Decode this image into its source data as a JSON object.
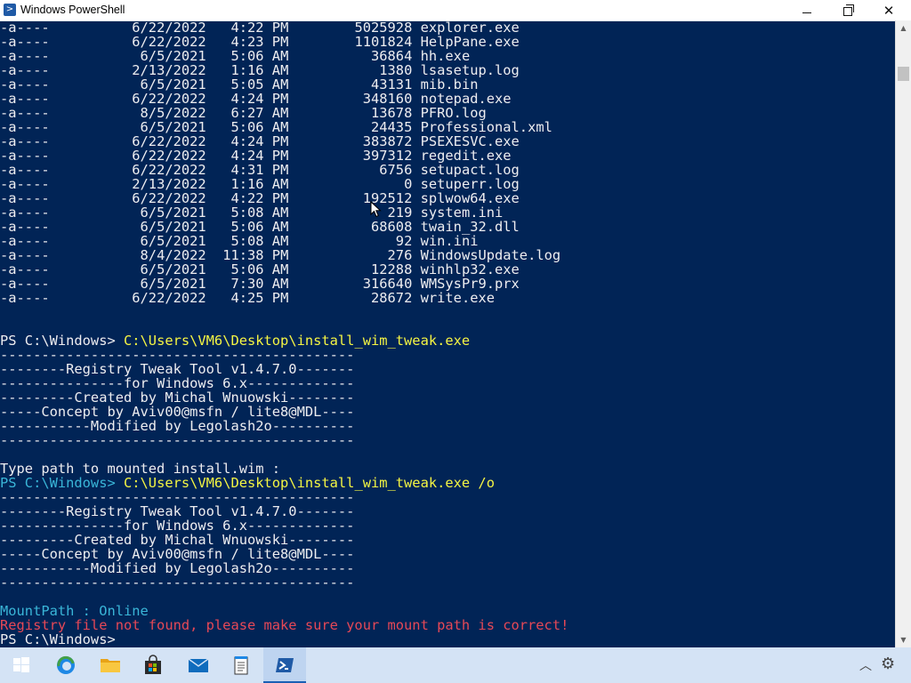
{
  "window": {
    "title": "Windows PowerShell"
  },
  "listing": [
    {
      "mode": "-a----",
      "date": "6/22/2022",
      "time": "4:22 PM",
      "length": "5025928",
      "name": "explorer.exe"
    },
    {
      "mode": "-a----",
      "date": "6/22/2022",
      "time": "4:23 PM",
      "length": "1101824",
      "name": "HelpPane.exe"
    },
    {
      "mode": "-a----",
      "date": "6/5/2021",
      "time": "5:06 AM",
      "length": "36864",
      "name": "hh.exe"
    },
    {
      "mode": "-a----",
      "date": "2/13/2022",
      "time": "1:16 AM",
      "length": "1380",
      "name": "lsasetup.log"
    },
    {
      "mode": "-a----",
      "date": "6/5/2021",
      "time": "5:05 AM",
      "length": "43131",
      "name": "mib.bin"
    },
    {
      "mode": "-a----",
      "date": "6/22/2022",
      "time": "4:24 PM",
      "length": "348160",
      "name": "notepad.exe"
    },
    {
      "mode": "-a----",
      "date": "8/5/2022",
      "time": "6:27 AM",
      "length": "13678",
      "name": "PFRO.log"
    },
    {
      "mode": "-a----",
      "date": "6/5/2021",
      "time": "5:06 AM",
      "length": "24435",
      "name": "Professional.xml"
    },
    {
      "mode": "-a----",
      "date": "6/22/2022",
      "time": "4:24 PM",
      "length": "383872",
      "name": "PSEXESVC.exe"
    },
    {
      "mode": "-a----",
      "date": "6/22/2022",
      "time": "4:24 PM",
      "length": "397312",
      "name": "regedit.exe"
    },
    {
      "mode": "-a----",
      "date": "6/22/2022",
      "time": "4:31 PM",
      "length": "6756",
      "name": "setupact.log"
    },
    {
      "mode": "-a----",
      "date": "2/13/2022",
      "time": "1:16 AM",
      "length": "0",
      "name": "setuperr.log"
    },
    {
      "mode": "-a----",
      "date": "6/22/2022",
      "time": "4:22 PM",
      "length": "192512",
      "name": "splwow64.exe"
    },
    {
      "mode": "-a----",
      "date": "6/5/2021",
      "time": "5:08 AM",
      "length": "219",
      "name": "system.ini"
    },
    {
      "mode": "-a----",
      "date": "6/5/2021",
      "time": "5:06 AM",
      "length": "68608",
      "name": "twain_32.dll"
    },
    {
      "mode": "-a----",
      "date": "6/5/2021",
      "time": "5:08 AM",
      "length": "92",
      "name": "win.ini"
    },
    {
      "mode": "-a----",
      "date": "8/4/2022",
      "time": "11:38 PM",
      "length": "276",
      "name": "WindowsUpdate.log"
    },
    {
      "mode": "-a----",
      "date": "6/5/2021",
      "time": "5:06 AM",
      "length": "12288",
      "name": "winhlp32.exe"
    },
    {
      "mode": "-a----",
      "date": "6/5/2021",
      "time": "7:30 AM",
      "length": "316640",
      "name": "WMSysPr9.prx"
    },
    {
      "mode": "-a----",
      "date": "6/22/2022",
      "time": "4:25 PM",
      "length": "28672",
      "name": "write.exe"
    }
  ],
  "session": {
    "prompt": "PS C:\\Windows> ",
    "command1": "C:\\Users\\VM6\\Desktop\\install_wim_tweak.exe",
    "command2": "C:\\Users\\VM6\\Desktop\\install_wim_tweak.exe /o",
    "banner": [
      "-------------------------------------------",
      "--------Registry Tweak Tool v1.4.7.0-------",
      "---------------for Windows 6.x-------------",
      "---------Created by Michal Wnuowski--------",
      "-----Concept by Aviv00@msfn / lite8@MDL----",
      "-----------Modified by Legolash2o----------",
      "-------------------------------------------"
    ],
    "type_path_msg": "Type path to mounted install.wim :",
    "mount_path": "MountPath : Online",
    "error_msg": "Registry file not found, please make sure your mount path is correct!"
  },
  "taskbar": {
    "apps": [
      "start-icon",
      "edge-icon",
      "file-explorer-icon",
      "store-icon",
      "mail-icon",
      "notepad-icon",
      "powershell-icon"
    ],
    "active": "powershell-icon"
  },
  "colors": {
    "console_bg": "#012456",
    "text": "#eeedf0",
    "command": "#f5f543",
    "info": "#3ab6d8",
    "error": "#e74856",
    "taskbar_bg": "#d4e3f5"
  }
}
